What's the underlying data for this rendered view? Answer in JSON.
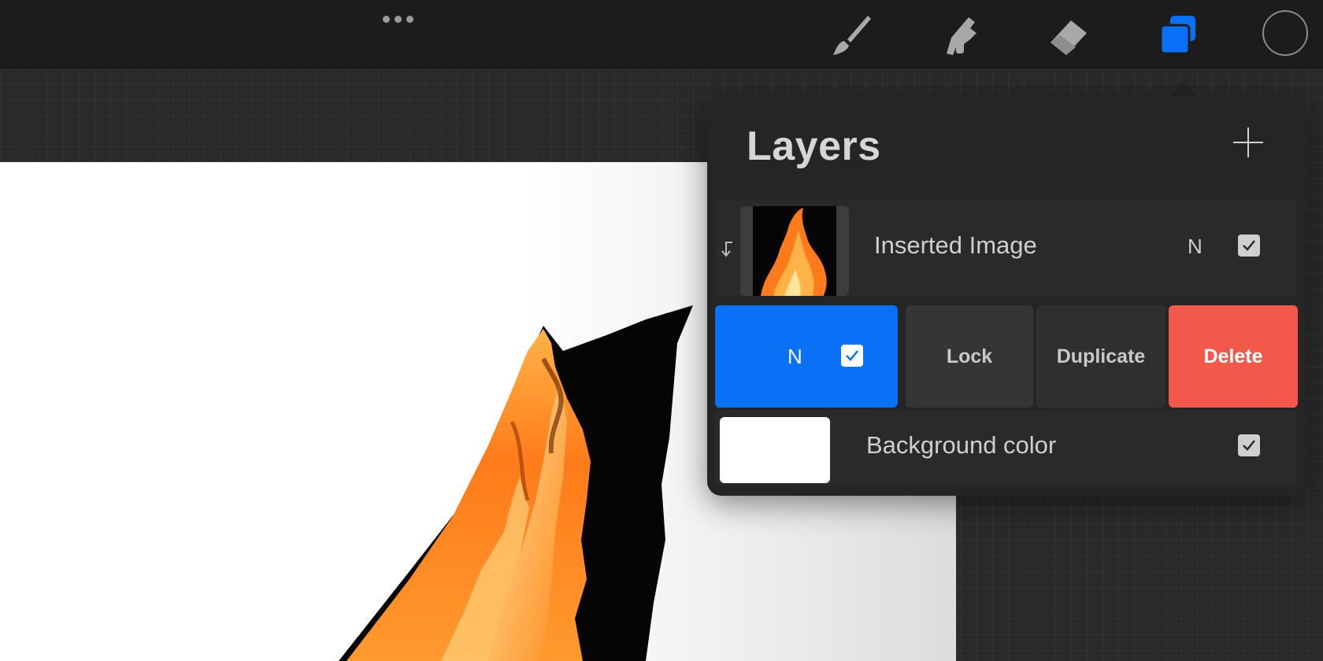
{
  "toolbar": {
    "menu_icon": "more-dots-icon",
    "tools": [
      {
        "name": "brush",
        "icon": "brush-icon",
        "active": false
      },
      {
        "name": "smudge",
        "icon": "smudge-icon",
        "active": false
      },
      {
        "name": "eraser",
        "icon": "eraser-icon",
        "active": false
      },
      {
        "name": "layers",
        "icon": "layers-icon",
        "active": true
      }
    ],
    "active_color": "#1c1c1c",
    "accent_color": "#0a70f5"
  },
  "layers_panel": {
    "title": "Layers",
    "add_icon": "plus-icon",
    "layers": [
      {
        "name": "Inserted Image",
        "blend_mode": "N",
        "visible": true,
        "clipping_mask": true,
        "thumbnail": "fire-image"
      },
      {
        "name": "",
        "blend_mode": "N",
        "visible": true,
        "selected": true,
        "swipe_actions": [
          "Lock",
          "Duplicate",
          "Delete"
        ]
      },
      {
        "name": "Background color",
        "visible": true,
        "swatch_color": "#ffffff"
      }
    ],
    "delete_color": "#f2594b"
  }
}
